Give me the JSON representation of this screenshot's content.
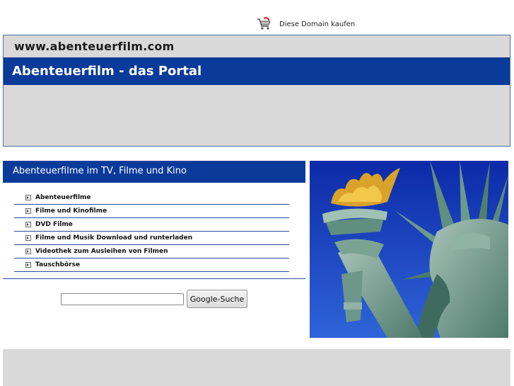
{
  "topbar": {
    "buy_domain_label": "Diese Domain kaufen",
    "icon": "shopping-cart-icon"
  },
  "header": {
    "domain": "www.abenteuerfilm.com",
    "portal_title": "Abenteuerfilm - das Portal"
  },
  "section": {
    "title": "Abenteuerfilme im TV, Filme und Kino",
    "links": [
      "Abenteuerfilme",
      "Filme und Kinofilme",
      "DVD Filme",
      "Filme und Musik Download und runterladen",
      "Videothek zum Ausleihen von Filmen",
      "Tauschbörse"
    ]
  },
  "search": {
    "value": "",
    "button_label": "Google-Suche"
  },
  "colors": {
    "primary_blue": "#0a3a9a",
    "panel_grey": "#d9d9d9",
    "photo_sky": "#1f48c8"
  }
}
